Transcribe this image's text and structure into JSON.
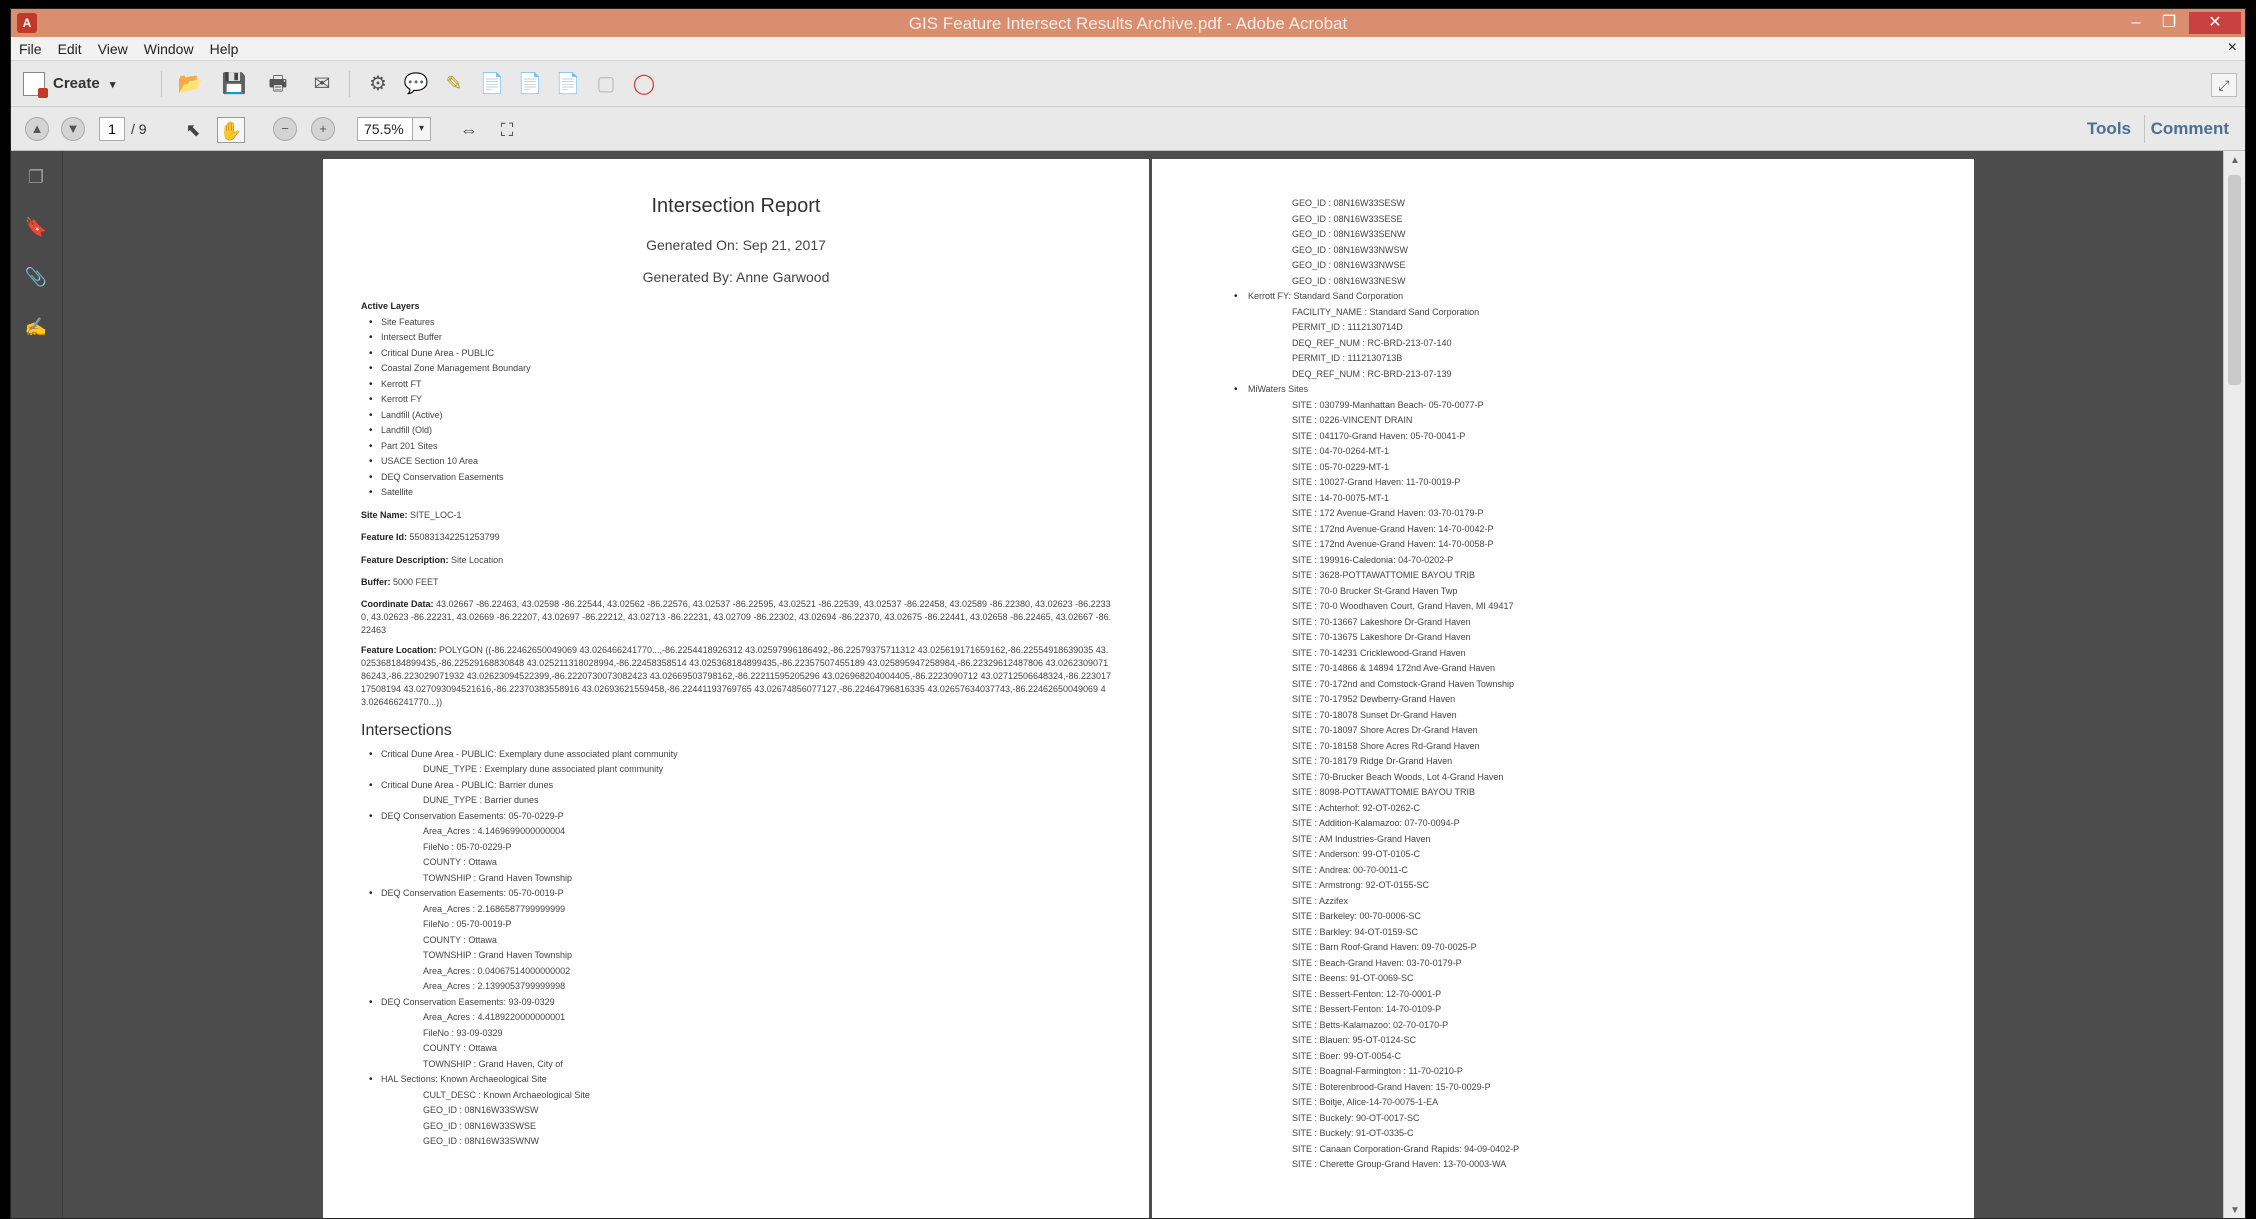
{
  "window": {
    "title": "GIS Feature Intersect Results Archive.pdf - Adobe Acrobat",
    "min": "–",
    "max": "❐",
    "close": "✕",
    "doc_close": "×"
  },
  "menu": [
    "File",
    "Edit",
    "View",
    "Window",
    "Help"
  ],
  "toolbar": {
    "create_label": "Create",
    "create_arrow": "▾"
  },
  "nav": {
    "page_current": "1",
    "page_total": "/ 9",
    "zoom": "75.5%",
    "zoom_arrow": "▾",
    "tools_label": "Tools",
    "comment_label": "Comment"
  },
  "page1": {
    "title": "Intersection Report",
    "generated_on": "Generated On: Sep 21, 2017",
    "generated_by": "Generated By: Anne Garwood",
    "active_layers_label": "Active Layers",
    "active_layers": [
      "Site Features",
      "Intersect Buffer",
      "Critical Dune Area - PUBLIC",
      "Coastal Zone Management Boundary",
      "Kerrott FT",
      "Kerrott FY",
      "Landfill (Active)",
      "Landfill (Old)",
      "Part 201 Sites",
      "USACE Section 10 Area",
      "DEQ Conservation Easements",
      "Satellite"
    ],
    "site_name_label": "Site Name:",
    "site_name": "SITE_LOC-1",
    "feature_id_label": "Feature Id:",
    "feature_id": "550831342251253799",
    "feature_desc_label": "Feature Description:",
    "feature_desc": "Site Location",
    "buffer_label": "Buffer:",
    "buffer": "5000 FEET",
    "coord_label": "Coordinate Data:",
    "coord": "43.02667 -86.22463, 43.02598 -86.22544, 43.02562 -86.22576, 43.02537 -86.22595, 43.02521 -86.22539, 43.02537 -86.22458, 43.02589 -86.22380, 43.02623 -86.22330, 43.02623 -86.22231, 43.02669 -86.22207, 43.02697 -86.22212, 43.02713 -86.22231, 43.02709 -86.22302, 43.02694 -86.22370, 43.02675 -86.22441, 43.02658 -86.22465, 43.02667 -86.22463",
    "location_label": "Feature Location:",
    "location": "POLYGON ((-86.22462650049069 43.026466241770...,-86.2254418926312 43.02597996186492,-86.22579375711312 43.025619171659162,-86.22554918639035 43.025368184899435,-86.22529168830848 43.025211318028994,-86.22458358514 43.025368184899435,-86.22357507455189 43.025895947258984,-86.22329612487806 43.026230907186243,-86.223029071932 43.02623094522399,-86.2220730073082423 43.02669503798162,-86.22211595205296 43.026968204004405,-86.2223090712 43.02712506648324,-86.22301717508194 43.027093094521616,-86.22370383558916 43.02693621559458,-86.22441193769765 43.02674856077127,-86.22464796816335 43.02657634037743,-86.22462650049069 43.026466241770...))",
    "intersections_label": "Intersections",
    "intersections": [
      {
        "head": "Critical Dune Area - PUBLIC: Exemplary dune associated plant community",
        "subs": [
          "DUNE_TYPE : Exemplary dune associated plant community"
        ]
      },
      {
        "head": "Critical Dune Area - PUBLIC: Barrier dunes",
        "subs": [
          "DUNE_TYPE : Barrier dunes"
        ]
      },
      {
        "head": "DEQ Conservation Easements: 05-70-0229-P",
        "subs": [
          "Area_Acres : 4.1469699000000004",
          "FileNo : 05-70-0229-P",
          "COUNTY : Ottawa",
          "TOWNSHIP : Grand Haven Township"
        ]
      },
      {
        "head": "DEQ Conservation Easements: 05-70-0019-P",
        "subs": [
          "Area_Acres : 2.1686587799999999",
          "FileNo : 05-70-0019-P",
          "COUNTY : Ottawa",
          "TOWNSHIP : Grand Haven Township",
          "Area_Acres : 0.04067514000000002",
          "Area_Acres : 2.1399053799999998"
        ]
      },
      {
        "head": "DEQ Conservation Easements: 93-09-0329",
        "subs": [
          "Area_Acres : 4.4189220000000001",
          "FileNo : 93-09-0329",
          "COUNTY : Ottawa",
          "TOWNSHIP : Grand Haven, City of"
        ]
      },
      {
        "head": "HAL Sections: Known Archaeological Site",
        "subs": [
          "CULT_DESC : Known Archaeological Site",
          "GEO_ID : 08N16W33SWSW",
          "GEO_ID : 08N16W33SWSE",
          "GEO_ID : 08N16W33SWNW"
        ]
      }
    ]
  },
  "page2": {
    "top_lines": [
      "GEO_ID : 08N16W33SESW",
      "GEO_ID : 08N16W33SESE",
      "GEO_ID : 08N16W33SENW",
      "GEO_ID : 08N16W33NWSW",
      "GEO_ID : 08N16W33NWSE",
      "GEO_ID : 08N16W33NESW"
    ],
    "kerrott_head": "Kerrott FY: Standard Sand Corporation",
    "kerrott_lines": [
      "FACILITY_NAME : Standard Sand Corporation",
      "PERMIT_ID : 1112130714D",
      "DEQ_REF_NUM : RC-BRD-213-07-140",
      "PERMIT_ID : 1112130713B",
      "DEQ_REF_NUM : RC-BRD-213-07-139"
    ],
    "mi_head": "MiWaters Sites",
    "mi_lines": [
      "SITE : 030799-Manhattan Beach- 05-70-0077-P",
      "SITE : 0226-VINCENT DRAIN",
      "SITE : 041170-Grand Haven: 05-70-0041-P",
      "SITE : 04-70-0264-MT-1",
      "SITE : 05-70-0229-MT-1",
      "SITE : 10027-Grand Haven: 11-70-0019-P",
      "SITE : 14-70-0075-MT-1",
      "SITE : 172 Avenue-Grand Haven: 03-70-0179-P",
      "SITE : 172nd Avenue-Grand Haven: 14-70-0042-P",
      "SITE : 172nd Avenue-Grand Haven: 14-70-0058-P",
      "SITE : 199916-Caledonia: 04-70-0202-P",
      "SITE : 3628-POTTAWATTOMIE BAYOU TRIB",
      "SITE : 70-0 Brucker St-Grand Haven Twp",
      "SITE : 70-0 Woodhaven Court, Grand Haven, MI 49417",
      "SITE : 70-13667 Lakeshore Dr-Grand Haven",
      "SITE : 70-13675 Lakeshore Dr-Grand Haven",
      "SITE : 70-14231 Cricklewood-Grand Haven",
      "SITE : 70-14866 & 14894 172nd Ave-Grand Haven",
      "SITE : 70-172nd and Comstock-Grand Haven Township",
      "SITE : 70-17952 Dewberry-Grand Haven",
      "SITE : 70-18078 Sunset Dr-Grand Haven",
      "SITE : 70-18097 Shore Acres Dr-Grand Haven",
      "SITE : 70-18158 Shore Acres Rd-Grand Haven",
      "SITE : 70-18179 Ridge Dr-Grand Haven",
      "SITE : 70-Brucker Beach Woods, Lot 4-Grand Haven",
      "SITE : 8098-POTTAWATTOMIE BAYOU TRIB",
      "SITE : Achterhof: 92-OT-0262-C",
      "SITE : Addition-Kalamazoo: 07-70-0094-P",
      "SITE : AM Industries-Grand Haven",
      "SITE : Anderson: 99-OT-0105-C",
      "SITE : Andrea: 00-70-0011-C",
      "SITE : Armstrong: 92-OT-0155-SC",
      "SITE : Azzifex",
      "SITE : Barkeley: 00-70-0006-SC",
      "SITE : Barkley: 94-OT-0159-SC",
      "SITE : Barn Roof-Grand Haven: 09-70-0025-P",
      "SITE : Beach-Grand Haven: 03-70-0179-P",
      "SITE : Beens: 91-OT-0069-SC",
      "SITE : Bessert-Fenton: 12-70-0001-P",
      "SITE : Bessert-Fenton: 14-70-0109-P",
      "SITE : Betts-Kalamazoo: 02-70-0170-P",
      "SITE : Blauen: 95-OT-0124-SC",
      "SITE : Boer: 99-OT-0054-C",
      "SITE : Boagnal-Farmington : 11-70-0210-P",
      "SITE : Boterenbrood-Grand Haven: 15-70-0029-P",
      "SITE : Boitje, Alice-14-70-0075-1-EA",
      "SITE : Buckely: 90-OT-0017-SC",
      "SITE : Buckely: 91-OT-0335-C",
      "SITE : Canaan Corporation-Grand Rapids: 94-09-0402-P",
      "SITE : Cherette Group-Grand Haven: 13-70-0003-WA"
    ]
  }
}
